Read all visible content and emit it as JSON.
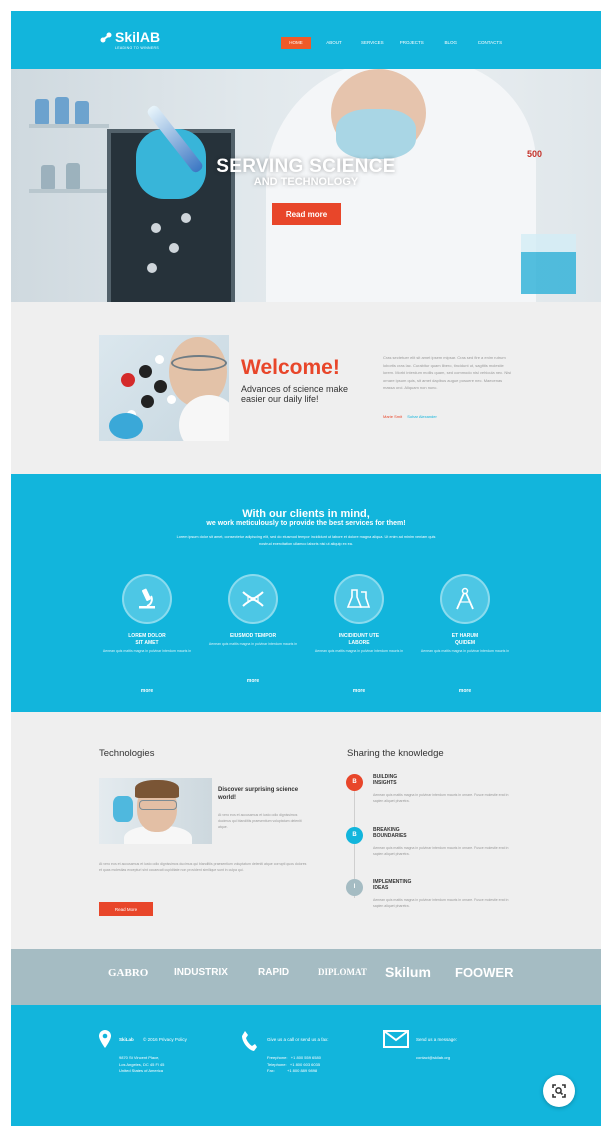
{
  "header": {
    "logo": "SkilAB",
    "tagline": "LEADING TO WINNERS",
    "nav": [
      "HOME",
      "ABOUT",
      "SERVICES",
      "PROJECTS",
      "BLOG",
      "CONTACTS"
    ],
    "active_index": 0
  },
  "hero": {
    "title": "SERVING SCIENCE",
    "subtitle": "AND TECHNOLOGY",
    "button": "Read more",
    "prev": "<",
    "next": ">",
    "beaker_label": "500"
  },
  "welcome": {
    "title": "Welcome!",
    "subtitle": "Advances of science make easier our daily life!",
    "text": "Cras sectetuer elit sit amet ipsem mipsar. Cras sed fire a enim rutrum lobortis cras lac. Curabitur quam libero, tincidunt ut, sagittis molestie lorem. Morbi interdum mollis quam, sed commodo nisl vehicula nec. Nisi ornare ipsum quis, sit amet dapibus augue posuere nec. Maecenas massa orci. Aliquam non nunc.",
    "link1": "Marie Smit",
    "link2": "Sohar Alexander"
  },
  "services": {
    "title": "With our clients in mind,",
    "subtitle": "we work meticulously to provide the best services for them!",
    "desc": "Lorem ipsum dolor sit amet, consectetur adipiscing elit, sed do eiusmod tempor incididunt ut labore et dolore magna aliqua. Ut enim ad minim veniam quis nostrud exercitation ullamco laboris nisi ut aliquip ex ea.",
    "items": [
      {
        "name": "LOREM DOLOR\nSIT AMET",
        "text": "Aenean quis mattis magna in pulvinar interdum mauris in",
        "more": "more"
      },
      {
        "name": "EIUSMOD TEMPOR",
        "text": "Aenean quis mattis magna in pulvinar interdum mauris in",
        "more": "more"
      },
      {
        "name": "INCIDIDUNT UTE\nLABORE",
        "text": "Aenean quis mattis magna in pulvinar interdum mauris in",
        "more": "more"
      },
      {
        "name": "ET HARUM\nQUIDEM",
        "text": "Aenean quis mattis magna in pulvinar interdum mauris in",
        "more": "more"
      }
    ]
  },
  "tech": {
    "heading": "Technologies",
    "title": "Discover surprising science world!",
    "p1": "At vero eos et accusamus et iusto odio dignissimos ducimus qui blanditiis praesentium voluptatum deleniti atque.",
    "p2": "At vero eos et accusamus et iusto odio dignissimos ducimus qui blanditiis praesentium voluptatum deleniti atque corrupti quos dolores et quas molestias excepturi sint occaecati cupiditate non provident similique sunt in culpa qui.",
    "button": "Read More"
  },
  "knowledge": {
    "heading": "Sharing the knowledge",
    "items": [
      {
        "num": "B",
        "title": "BUILDING\nINSIGHTS",
        "text": "Aenean quis mattis magna in pulvinar interdum mauris in ornare. Fusce molestie erat in sapien aliquet pharetra.",
        "color": "#e8462a"
      },
      {
        "num": "B",
        "title": "BREAKING\nBOUNDARIES",
        "text": "Aenean quis mattis magna in pulvinar interdum mauris in ornare. Fusce molestie erat in sapien aliquet pharetra.",
        "color": "#12b5dc"
      },
      {
        "num": "I",
        "title": "IMPLEMENTING\nIDEAS",
        "text": "Aenean quis mattis magna in pulvinar interdum mauris in ornare. Fusce molestie erat in sapien aliquet pharetra.",
        "color": "#a5bcc3"
      }
    ]
  },
  "brands": [
    "GABRO",
    "INDUSTRIX",
    "RAPID",
    "DIPLOMAT",
    "Skilum",
    "FOOWER"
  ],
  "footer": {
    "company": "SkiLab",
    "copyright": "© 2016 Privacy Policy",
    "address": "9870 St Vincent Place,\nLos Angeles, DC 45 Fl 45\nUnited States of America",
    "call_head": "Give us a call or send us a fax:",
    "phones": "Freephone:   +1 800 559 6580\nTelephone:   +1 800 603 6035\nFax:           +1 800 889 9898",
    "msg_head": "Send us a message:",
    "email": "contact@skilab.org"
  },
  "colors": {
    "accent": "#12b5dc",
    "cta": "#e8462a",
    "brandbar": "#a5bcc3"
  }
}
